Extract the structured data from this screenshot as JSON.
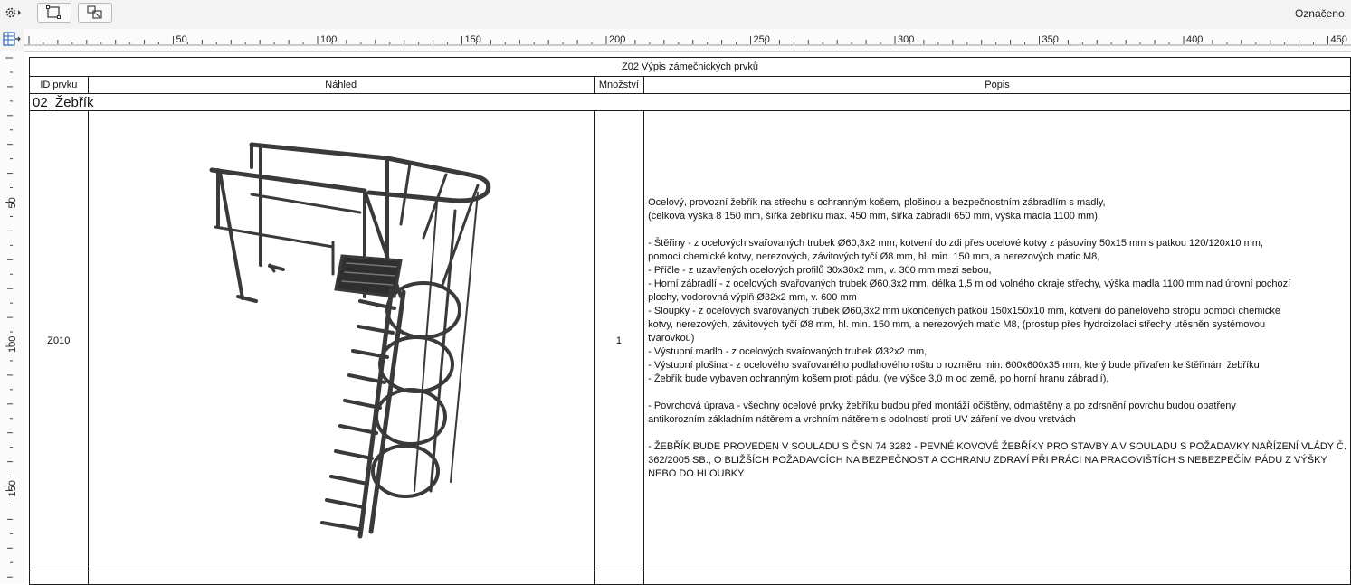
{
  "toolbar": {
    "selected_label": "Označeno:",
    "buttons": [
      {
        "name": "settings-menu-button",
        "icon": "gear-icon"
      },
      {
        "name": "select-frame-button",
        "icon": "frame-select-icon"
      },
      {
        "name": "select-elements-button",
        "icon": "elements-select-icon"
      }
    ]
  },
  "ruler": {
    "corner_icon": "table-settings-icon",
    "h_labels": [
      "50",
      "100",
      "150",
      "200",
      "250",
      "300",
      "350",
      "400",
      "450"
    ],
    "v_labels": [
      "50",
      "100",
      "150"
    ]
  },
  "schedule": {
    "title": "Z02 Výpis zámečnických prvků",
    "headers": [
      "ID prvku",
      "Náhled",
      "Množství",
      "Popis"
    ],
    "group": "02_Žebřík",
    "row": {
      "id": "Z010",
      "preview_icon": "ladder-3d-preview",
      "quantity": "1",
      "description": [
        "Ocelový, provozní žebřík na střechu s ochranným košem, plošinou a bezpečnostním zábradlím s madly,",
        "(celková výška 8 150 mm, šířka žebříku max. 450 mm, šířka zábradlí 650 mm, výška madla 1100 mm)",
        "",
        "- Štěřiny - z ocelových svařovaných trubek Ø60,3x2 mm, kotvení do zdi přes ocelové kotvy z pásoviny 50x15 mm s patkou 120/120x10 mm,",
        "pomocí chemické kotvy, nerezových, závitových tyčí Ø8 mm, hl. min. 150 mm, a  nerezových matic M8,",
        "- Příčle - z uzavřených ocelových profilů 30x30x2 mm,  v. 300 mm mezi sebou,",
        "- Horní zábradlí - z ocelových svařovaných trubek Ø60,3x2 mm, délka 1,5 m od volného okraje střechy, výška madla 1100 mm nad úrovní pochozí",
        "plochy, vodorovná výplň Ø32x2 mm, v. 600 mm",
        "- Sloupky - z ocelových svařovaných trubek Ø60,3x2 mm ukončených patkou 150x150x10 mm, kotvení do panelového stropu pomocí chemické",
        "kotvy, nerezových, závitových tyčí Ø8 mm, hl. min. 150 mm, a  nerezových matic M8, (prostup přes hydroizolaci střechy utěsněn systémovou",
        "tvarovkou)",
        "- Výstupní madlo  - z ocelových svařovaných trubek Ø32x2 mm,",
        "- Výstupní plošina - z ocelového svařovaného podlahového roštu o rozměru min. 600x600x35 mm, který bude přivařen ke štěřinám žebříku",
        "- Žebřík bude vybaven ochranným košem proti pádu, (ve výšce 3,0 m od země, po horní hranu zábradlí),",
        "",
        "- Povrchová úprava - všechny ocelové prvky žebříku budou před montáží očištěny, odmaštěny a po zdrsnění povrchu budou opatřeny",
        "antikorozním základním nátěrem a vrchním nátěrem s odolností proti UV záření  ve dvou vrstvách",
        "",
        "- ŽEBŘÍK BUDE PROVEDEN V SOULADU S ČSN 74 3282 - PEVNÉ KOVOVÉ ŽEBŘÍKY PRO STAVBY A V SOULADU S POŽADAVKY NAŘÍZENÍ VLÁDY Č.",
        "362/2005 SB., O BLIŽŠÍCH POŽADAVCÍCH NA BEZPEČNOST A OCHRANU ZDRAVÍ PŘI PRÁCI NA PRACOVIŠTÍCH S NEBEZPEČÍM PÁDU Z VÝŠKY",
        "NEBO DO HLOUBKY"
      ]
    }
  }
}
